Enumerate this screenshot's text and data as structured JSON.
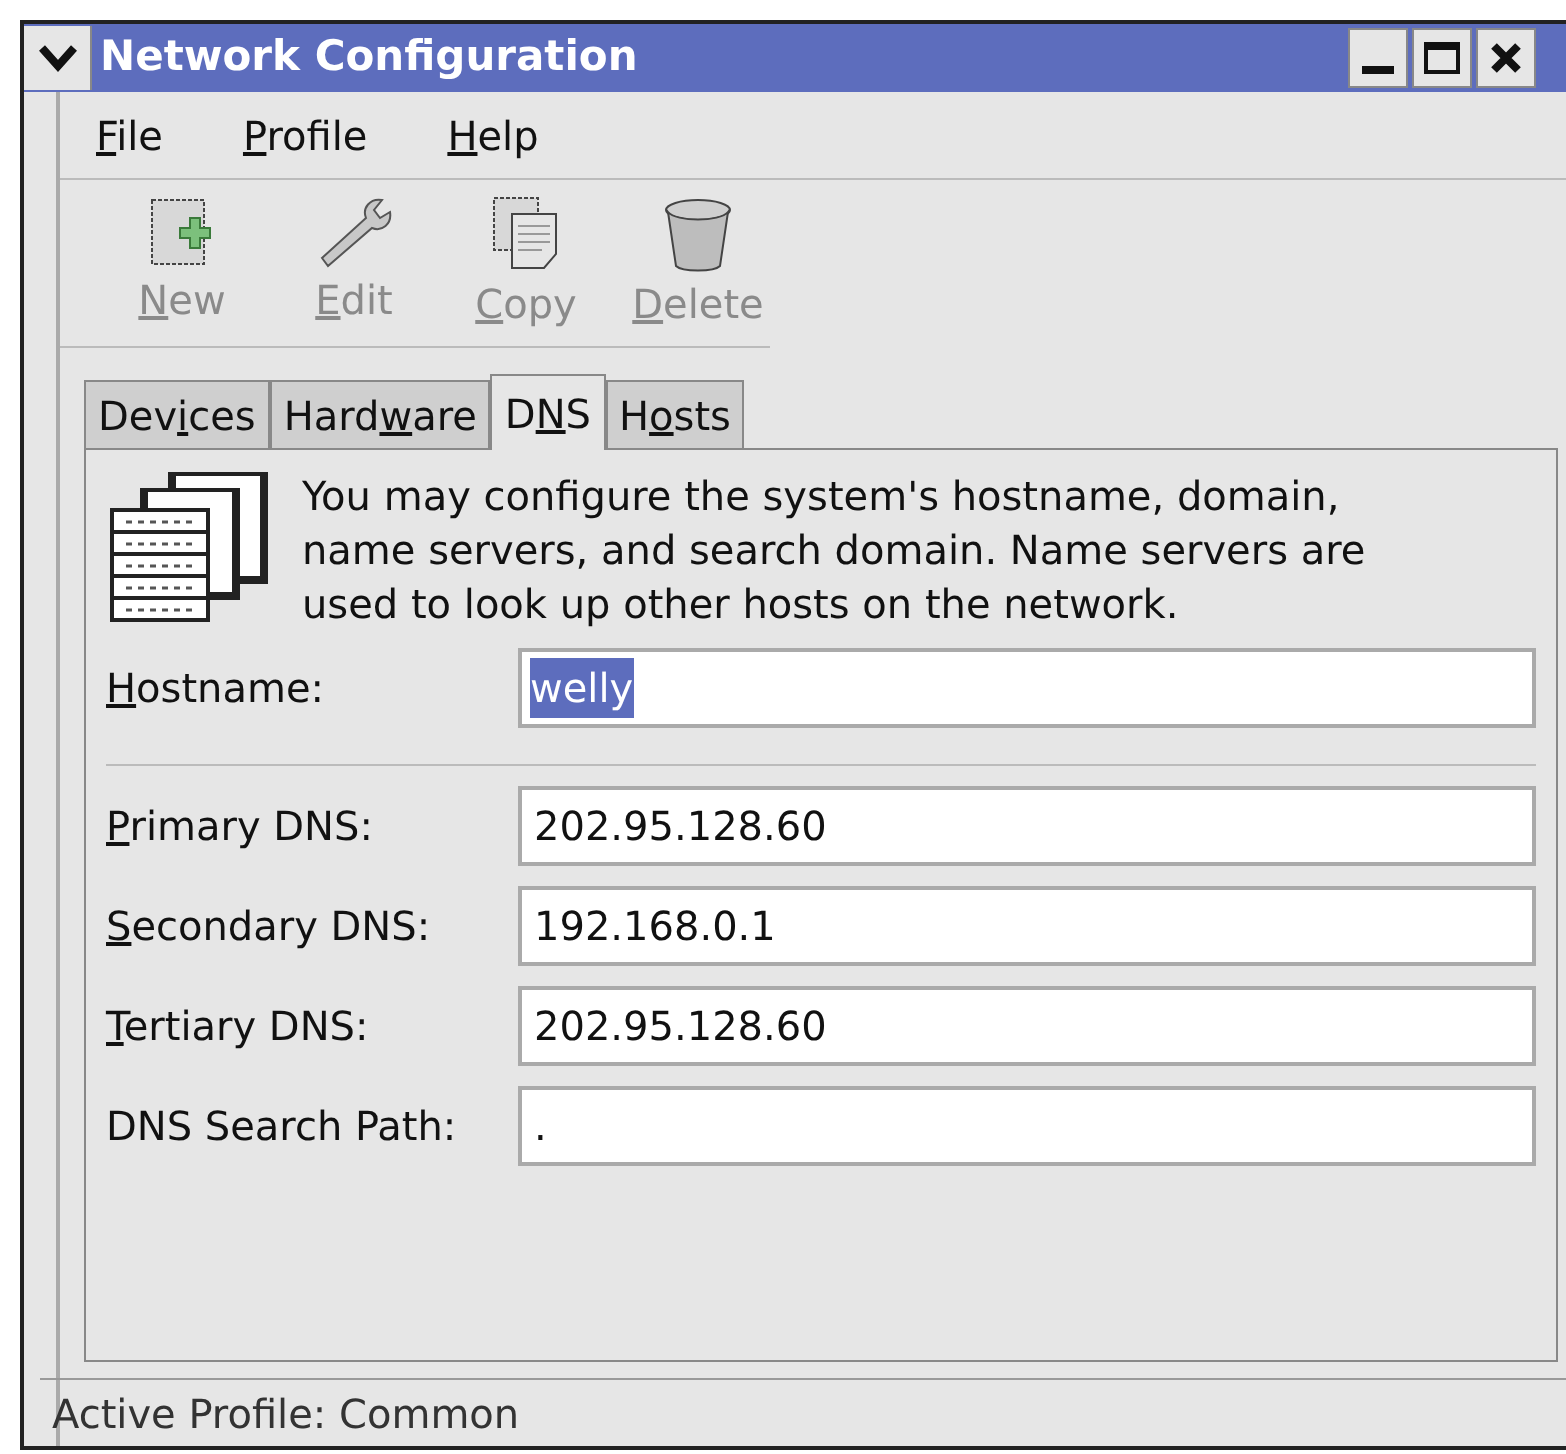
{
  "window": {
    "title": "Network Configuration"
  },
  "menu": [
    {
      "parts": [
        {
          "text": "F",
          "underlined": true
        },
        {
          "text": "ile",
          "underlined": false
        }
      ]
    },
    {
      "parts": [
        {
          "text": "P",
          "underlined": true
        },
        {
          "text": "rofile",
          "underlined": false
        }
      ]
    },
    {
      "parts": [
        {
          "text": "H",
          "underlined": true
        },
        {
          "text": "elp",
          "underlined": false
        }
      ]
    }
  ],
  "toolbar": [
    {
      "parts": [
        {
          "text": "N",
          "underlined": true
        },
        {
          "text": "ew",
          "underlined": false
        }
      ],
      "kind": "new",
      "disabled": true
    },
    {
      "parts": [
        {
          "text": "E",
          "underlined": true
        },
        {
          "text": "dit",
          "underlined": false
        }
      ],
      "kind": "edit",
      "disabled": true
    },
    {
      "parts": [
        {
          "text": "C",
          "underlined": true
        },
        {
          "text": "opy",
          "underlined": false
        }
      ],
      "kind": "copy",
      "disabled": true
    },
    {
      "parts": [
        {
          "text": "D",
          "underlined": true
        },
        {
          "text": "elete",
          "underlined": false
        }
      ],
      "kind": "delete",
      "disabled": true
    }
  ],
  "tabs": [
    {
      "parts": [
        {
          "text": "Dev",
          "underlined": false
        },
        {
          "text": "i",
          "underlined": true
        },
        {
          "text": "ces",
          "underlined": false
        }
      ],
      "selected": false
    },
    {
      "parts": [
        {
          "text": "Hard",
          "underlined": false
        },
        {
          "text": "w",
          "underlined": true
        },
        {
          "text": "are",
          "underlined": false
        }
      ],
      "selected": false
    },
    {
      "parts": [
        {
          "text": "D",
          "underlined": false
        },
        {
          "text": "N",
          "underlined": true
        },
        {
          "text": "S",
          "underlined": false
        }
      ],
      "selected": true
    },
    {
      "parts": [
        {
          "text": "H",
          "underlined": false
        },
        {
          "text": "o",
          "underlined": true
        },
        {
          "text": "sts",
          "underlined": false
        }
      ],
      "selected": false
    }
  ],
  "description": "You may configure the system's hostname, domain, name servers, and search domain. Name servers are used to look up other hosts on the network.",
  "hostname": {
    "parts": [
      {
        "text": "H",
        "underlined": true
      },
      {
        "text": "ostname:",
        "underlined": false
      }
    ],
    "value": "welly",
    "selected": true
  },
  "dns_fields": [
    {
      "parts": [
        {
          "text": "P",
          "underlined": true
        },
        {
          "text": "rimary DNS:",
          "underlined": false
        }
      ],
      "value": "202.95.128.60"
    },
    {
      "parts": [
        {
          "text": "S",
          "underlined": true
        },
        {
          "text": "econdary DNS:",
          "underlined": false
        }
      ],
      "value": "192.168.0.1"
    },
    {
      "parts": [
        {
          "text": "T",
          "underlined": true
        },
        {
          "text": "ertiary DNS:",
          "underlined": false
        }
      ],
      "value": "202.95.128.60"
    },
    {
      "parts": [
        {
          "text": "DNS Search Path:",
          "underlined": false
        }
      ],
      "value": "."
    }
  ],
  "status_bar": "Active Profile: Common"
}
